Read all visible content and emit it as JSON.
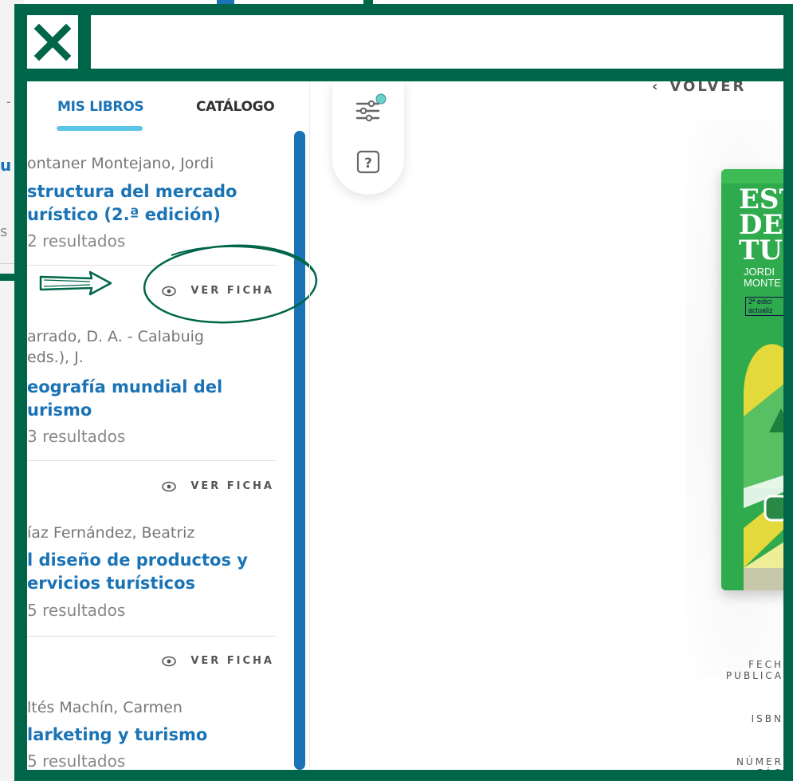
{
  "background_sidebar": {
    "fragment": "u",
    "s": "s",
    "dash": "-"
  },
  "tabs": [
    {
      "label": "MIS LIBROS",
      "active": true
    },
    {
      "label": "CATÁLOGO",
      "active": false
    }
  ],
  "books": [
    {
      "author": "ontaner Montejano, Jordi",
      "title": "structura del mercado\nurístico (2.ª edición)",
      "results": "2 resultados"
    },
    {
      "author": "arrado, D. A. - Calabuig\neds.), J.",
      "title": "eografía mundial del\nurismo",
      "results": "3 resultados"
    },
    {
      "author": "íaz Fernández, Beatriz",
      "title": "l diseño de productos y\nervicios turísticos",
      "results": "5 resultados"
    },
    {
      "author": "ltés Machín, Carmen",
      "title": "larketing y turismo",
      "results": "5 resultados"
    }
  ],
  "ver_ficha_label": "VER FICHA",
  "detail": {
    "back_label": "VOLVER",
    "cover": {
      "title_lines": [
        "EST",
        "DE",
        "TU"
      ],
      "author_lines": [
        "JORDI",
        "MONTE"
      ],
      "edition_lines": [
        "2ª edici",
        "actualiz"
      ]
    },
    "meta_labels": {
      "fecha": "FECH\nPUBLICA",
      "isbn": "ISBN",
      "numero": "NÚMER\nPÁG"
    }
  },
  "colors": {
    "frame_green": "#00664a",
    "link_blue": "#1a73b5",
    "tab_underline": "#5bc5e8",
    "cover_green": "#2faa4d"
  },
  "icons": [
    "close-icon",
    "filter-sliders-icon",
    "help-icon",
    "eye-icon",
    "back-chevron-icon",
    "arrow-right-icon"
  ]
}
